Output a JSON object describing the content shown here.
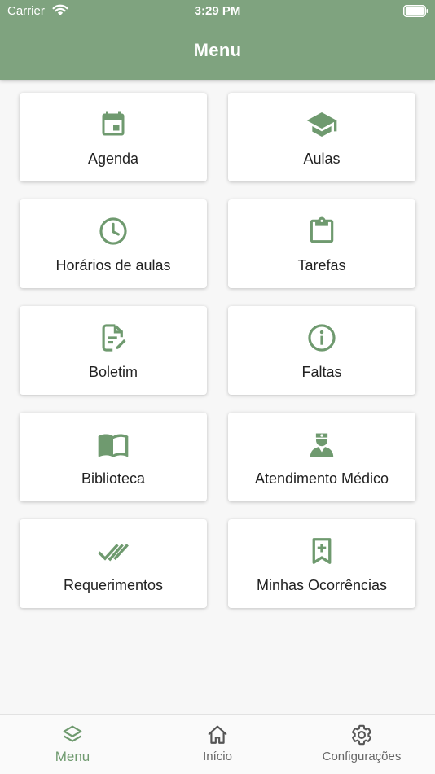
{
  "status_bar": {
    "carrier": "Carrier",
    "time": "3:29 PM"
  },
  "header": {
    "title": "Menu"
  },
  "colors": {
    "accent": "#7fa37f",
    "icon": "#6f9a6f",
    "background": "#f7f7f7"
  },
  "menu_items": [
    {
      "label": "Agenda",
      "icon": "calendar-icon"
    },
    {
      "label": "Aulas",
      "icon": "graduation-cap-icon"
    },
    {
      "label": "Horários de aulas",
      "icon": "clock-icon"
    },
    {
      "label": "Tarefas",
      "icon": "clipboard-icon"
    },
    {
      "label": "Boletim",
      "icon": "report-edit-icon"
    },
    {
      "label": "Faltas",
      "icon": "info-icon"
    },
    {
      "label": "Biblioteca",
      "icon": "book-icon"
    },
    {
      "label": "Atendimento Médico",
      "icon": "doctor-icon"
    },
    {
      "label": "Requerimentos",
      "icon": "double-check-icon"
    },
    {
      "label": "Minhas Ocorrências",
      "icon": "bookmark-plus-icon"
    }
  ],
  "tab_bar": {
    "tabs": [
      {
        "label": "Menu",
        "icon": "layers-icon",
        "active": true
      },
      {
        "label": "Início",
        "icon": "home-icon",
        "active": false
      },
      {
        "label": "Configurações",
        "icon": "gear-icon",
        "active": false
      }
    ]
  }
}
